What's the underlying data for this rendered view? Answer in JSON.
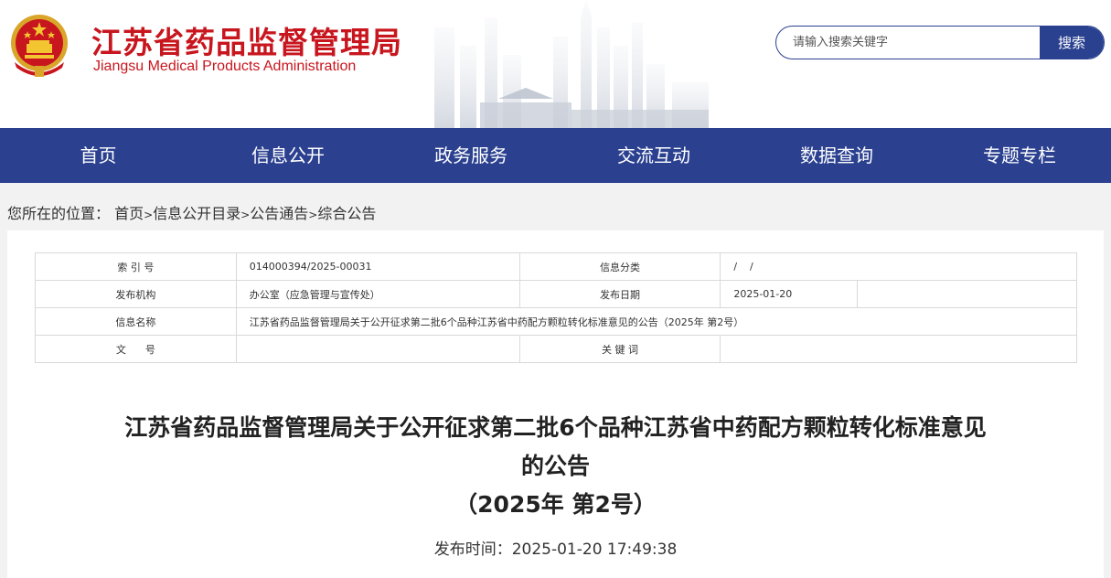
{
  "header": {
    "title_cn": "江苏省药品监督管理局",
    "title_en": "Jiangsu Medical Products Administration",
    "search_placeholder": "请输入搜索关键字",
    "search_button": "搜索",
    "colors": {
      "brand_red": "#c8161e",
      "brand_blue": "#2b4190"
    }
  },
  "nav": {
    "items": [
      "首页",
      "信息公开",
      "政务服务",
      "交流互动",
      "数据查询",
      "专题专栏"
    ]
  },
  "breadcrumb": {
    "prefix": "您所在的位置：",
    "items": [
      "首页",
      "信息公开目录",
      "公告通告",
      "综合公告"
    ],
    "separator": ">"
  },
  "meta": {
    "index_label": "索 引 号",
    "index_value": "014000394/2025-00031",
    "category_label": "信息分类",
    "category_value": "/    /",
    "org_label": "发布机构",
    "org_value": "办公室（应急管理与宣传处）",
    "date_label": "发布日期",
    "date_value": "2025-01-20",
    "name_label": "信息名称",
    "name_value": "江苏省药品监督管理局关于公开征求第二批6个品种江苏省中药配方颗粒转化标准意见的公告（2025年 第2号）",
    "doc_label": "文      号",
    "doc_value": "",
    "keywords_label": "关 键 词",
    "keywords_value": ""
  },
  "article": {
    "title_line1": "江苏省药品监督管理局关于公开征求第二批6个品种江苏省中药配方颗粒转化标准意见",
    "title_line2": "的公告",
    "title_line3": "（2025年 第2号）",
    "publish_label": "发布时间：",
    "publish_time": "2025-01-20 17:49:38"
  }
}
